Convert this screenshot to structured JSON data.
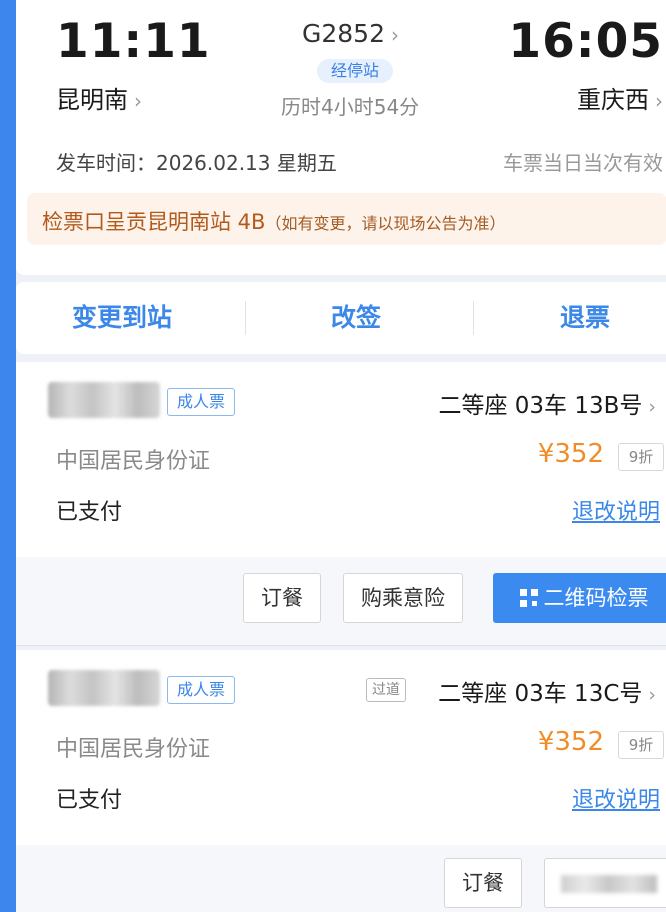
{
  "trip": {
    "departure_time": "11:11",
    "departure_station": "昆明南",
    "arrival_time": "16:05",
    "arrival_station": "重庆西",
    "train_number": "G2852",
    "stops_label": "经停站",
    "duration": "历时4小时54分",
    "departure_date": "发车时间：2026.02.13 星期五",
    "validity": "车票当日当次有效",
    "gate_main": "检票口呈贡昆明南站 4B",
    "gate_note": "（如有变更，请以现场公告为准）"
  },
  "actions": {
    "change_destination": "变更到站",
    "reschedule": "改签",
    "refund": "退票"
  },
  "passengers": [
    {
      "ticket_type": "成人票",
      "seat": "二等座 03车 13B号",
      "id_type": "中国居民身份证",
      "price": "¥352",
      "discount": "9折",
      "status": "已支付",
      "rules_link": "退改说明",
      "aisle_tag": ""
    },
    {
      "ticket_type": "成人票",
      "seat": "二等座 03车 13C号",
      "id_type": "中国居民身份证",
      "price": "¥352",
      "discount": "9折",
      "status": "已支付",
      "rules_link": "退改说明",
      "aisle_tag": "过道"
    }
  ],
  "buttons": {
    "meal": "订餐",
    "insurance": "购乘意险",
    "qr_checkin": "二维码检票"
  },
  "colors": {
    "accent_blue": "#3b88e8",
    "price_orange": "#f18c2b",
    "gate_text": "#b25a1c"
  },
  "icons": {
    "chevron": "chevron-right-icon",
    "qr": "qr-code-icon"
  }
}
